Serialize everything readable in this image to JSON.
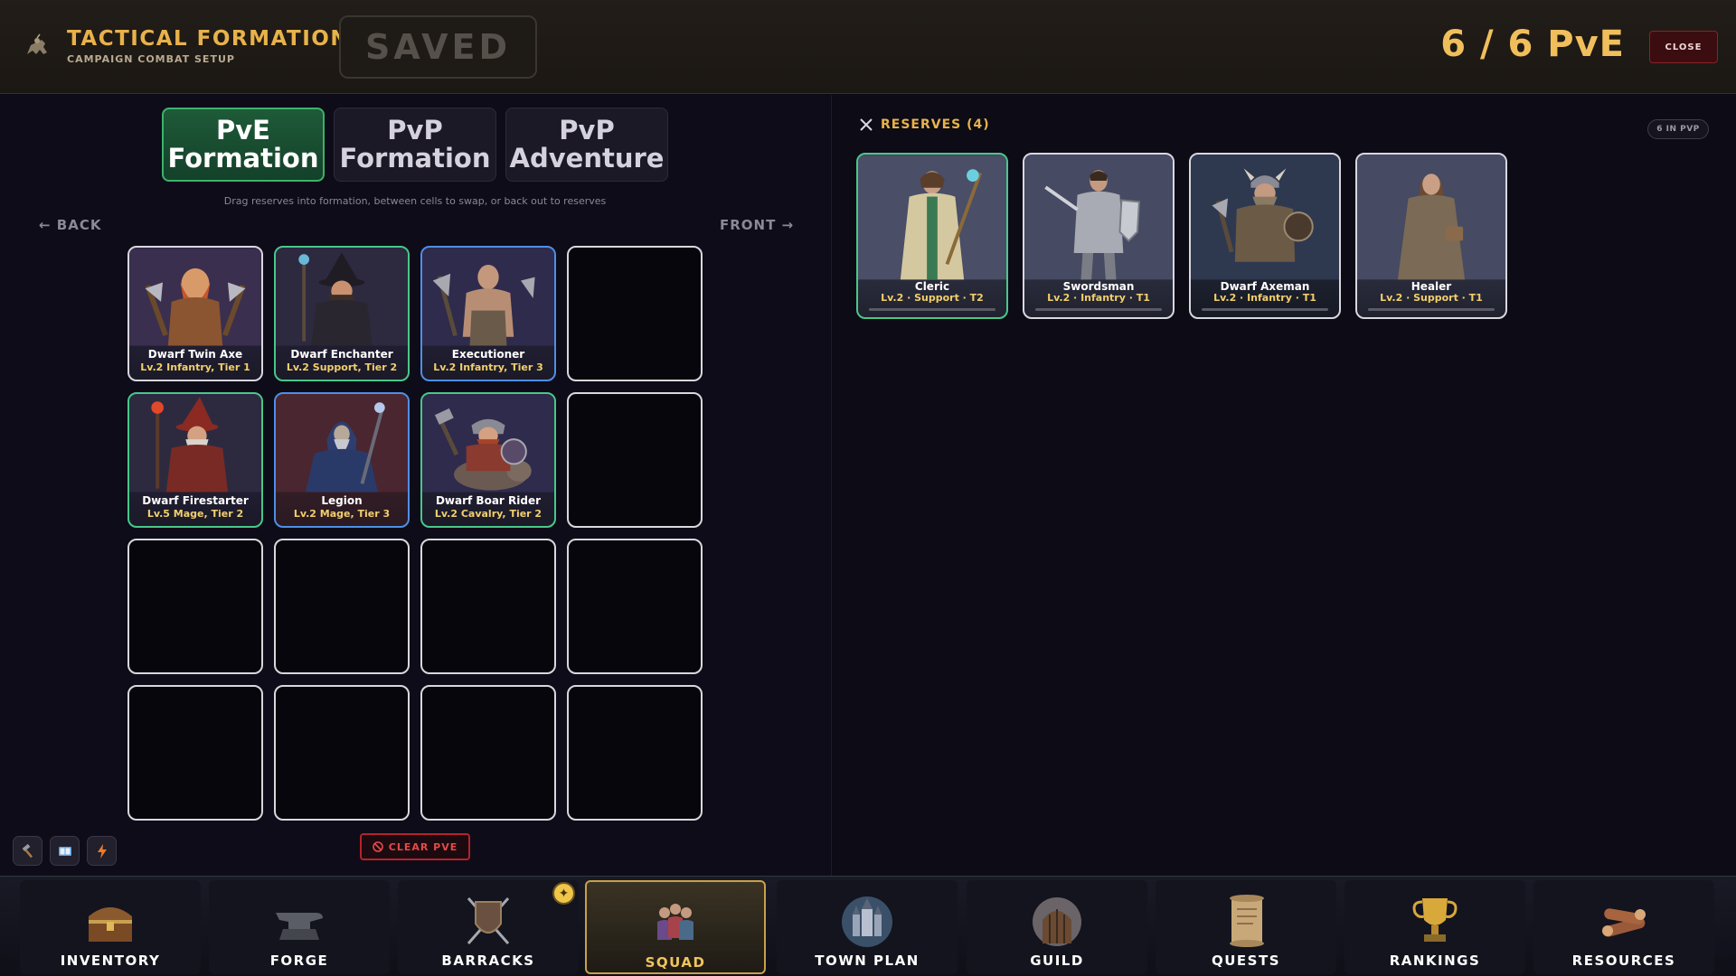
{
  "header": {
    "title": "TACTICAL FORMATION",
    "subtitle": "CAMPAIGN COMBAT SETUP",
    "saved": "SAVED",
    "count": "6 / 6 PvE",
    "close": "CLOSE",
    "logo_icon": "horse-rider-icon"
  },
  "tabs": [
    {
      "line1": "PvE",
      "line2": "Formation",
      "active": true
    },
    {
      "line1": "PvP",
      "line2": "Formation",
      "active": false
    },
    {
      "line1": "PvP",
      "line2": "Adventure",
      "active": false
    }
  ],
  "hint": "Drag reserves into formation, between cells to swap, or back out to reserves",
  "back_label": "← BACK",
  "front_label": "FRONT →",
  "formation": [
    {
      "name": "Dwarf Twin Axe",
      "meta": "Lv.2 Infantry, Tier 1",
      "border": "white"
    },
    {
      "name": "Dwarf Enchanter",
      "meta": "Lv.2 Support, Tier 2",
      "border": "green"
    },
    {
      "name": "Executioner",
      "meta": "Lv.2 Infantry, Tier 3",
      "border": "blue"
    },
    {
      "name": "Dwarf Firestarter",
      "meta": "Lv.5 Mage, Tier 2",
      "border": "green"
    },
    {
      "name": "Legion",
      "meta": "Lv.2 Mage, Tier 3",
      "border": "blue"
    },
    {
      "name": "Dwarf Boar Rider",
      "meta": "Lv.2 Cavalry, Tier 2",
      "border": "green"
    }
  ],
  "tools": [
    "hammer-icon",
    "book-icon",
    "lightning-icon"
  ],
  "clear_label": "CLEAR PVE",
  "reserves": {
    "title": "RESERVES (4)",
    "chip": "6 IN PVP",
    "units": [
      {
        "name": "Cleric",
        "meta": "Lv.2 · Support · T2"
      },
      {
        "name": "Swordsman",
        "meta": "Lv.2 · Infantry · T1"
      },
      {
        "name": "Dwarf Axeman",
        "meta": "Lv.2 · Infantry · T1"
      },
      {
        "name": "Healer",
        "meta": "Lv.2 · Support · T1"
      }
    ]
  },
  "nav": [
    {
      "label": "INVENTORY",
      "icon": "treasure-chest-icon"
    },
    {
      "label": "FORGE",
      "icon": "anvil-icon"
    },
    {
      "label": "BARRACKS",
      "icon": "shield-swords-icon"
    },
    {
      "label": "SQUAD",
      "icon": "squad-icon",
      "active": true
    },
    {
      "label": "TOWN PLAN",
      "icon": "castle-icon"
    },
    {
      "label": "GUILD",
      "icon": "gate-icon"
    },
    {
      "label": "QUESTS",
      "icon": "scroll-icon"
    },
    {
      "label": "RANKINGS",
      "icon": "trophy-icon"
    },
    {
      "label": "RESOURCES",
      "icon": "logs-icon"
    }
  ],
  "colors": {
    "accent_gold": "#e8b24a",
    "active_green": "#3bb36a",
    "danger_red": "#b4232a"
  }
}
